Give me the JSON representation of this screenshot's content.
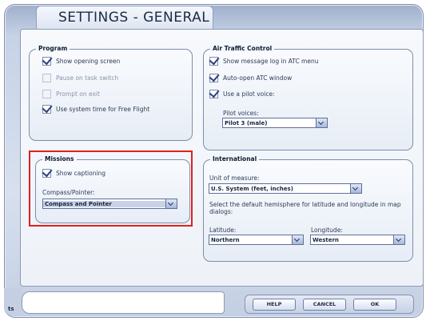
{
  "title": "SETTINGS - GENERAL",
  "program": {
    "legend": "Program",
    "options": [
      {
        "label": "Show opening screen",
        "checked": true,
        "enabled": true
      },
      {
        "label": "Pause on task switch",
        "checked": false,
        "enabled": false
      },
      {
        "label": "Prompt on exit",
        "checked": false,
        "enabled": false
      },
      {
        "label": "Use system time for Free Flight",
        "checked": true,
        "enabled": true
      }
    ]
  },
  "atc": {
    "legend": "Air Traffic Control",
    "options": [
      {
        "label": "Show message log in ATC menu",
        "checked": true
      },
      {
        "label": "Auto-open ATC window",
        "checked": true
      },
      {
        "label": "Use a pilot voice:",
        "checked": true
      }
    ],
    "pilot_voices_label": "Pilot voices:",
    "pilot_voices_value": "Pilot 3 (male)"
  },
  "missions": {
    "legend": "Missions",
    "show_captioning_label": "Show captioning",
    "show_captioning_checked": true,
    "compass_label": "Compass/Pointer:",
    "compass_value": "Compass and Pointer"
  },
  "international": {
    "legend": "International",
    "unit_label": "Unit of measure:",
    "unit_value": "U.S. System (feet, inches)",
    "hemisphere_text": "Select the default hemisphere for latitude and longitude in map dialogs:",
    "latitude_label": "Latitude:",
    "latitude_value": "Northern",
    "longitude_label": "Longitude:",
    "longitude_value": "Western"
  },
  "buttons": {
    "help": "HELP",
    "cancel": "CANCEL",
    "ok": "OK"
  },
  "bottom_tab_label": "ts"
}
